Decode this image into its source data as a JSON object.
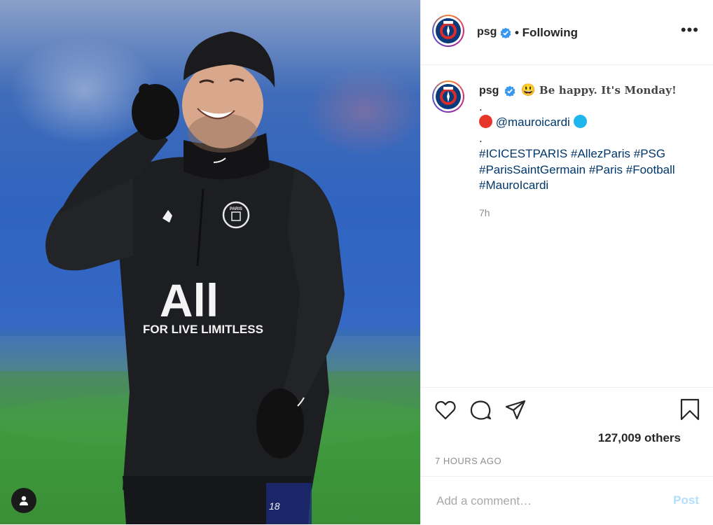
{
  "post": {
    "username": "psg",
    "follow_status": "• Following",
    "more_label": "•••"
  },
  "caption": {
    "username": "psg",
    "emoji": "😃",
    "headline": "Be happy. It's Monday!",
    "separator": ".",
    "mention": "@mauroicardi",
    "hashtags_line1": "#ICICESTPARIS #AllezParis #PSG",
    "hashtags_line2": "#ParisSaintGermain #Paris #Football",
    "hashtags_line3": "#MauroIcardi",
    "time_ago": "7h"
  },
  "photo": {
    "shirt_brand": "All",
    "shirt_slogan": "FOR LIVE LIMITLESS",
    "crest_text": "PARIS",
    "number": "18"
  },
  "engagement": {
    "likes": "127,009 others",
    "timestamp": "7 HOURS AGO"
  },
  "comment": {
    "placeholder": "Add a comment…",
    "post_label": "Post"
  },
  "icons": [
    "heart-icon",
    "comment-icon",
    "share-icon",
    "bookmark-icon",
    "verified-icon",
    "user-tag-icon",
    "more-options-icon"
  ],
  "colors": {
    "accent_link": "#00376b",
    "verified_blue": "#3897f0",
    "post_disabled": "#b2dffc",
    "red_dot": "#e8352a",
    "blue_dot": "#1fb6ee"
  }
}
